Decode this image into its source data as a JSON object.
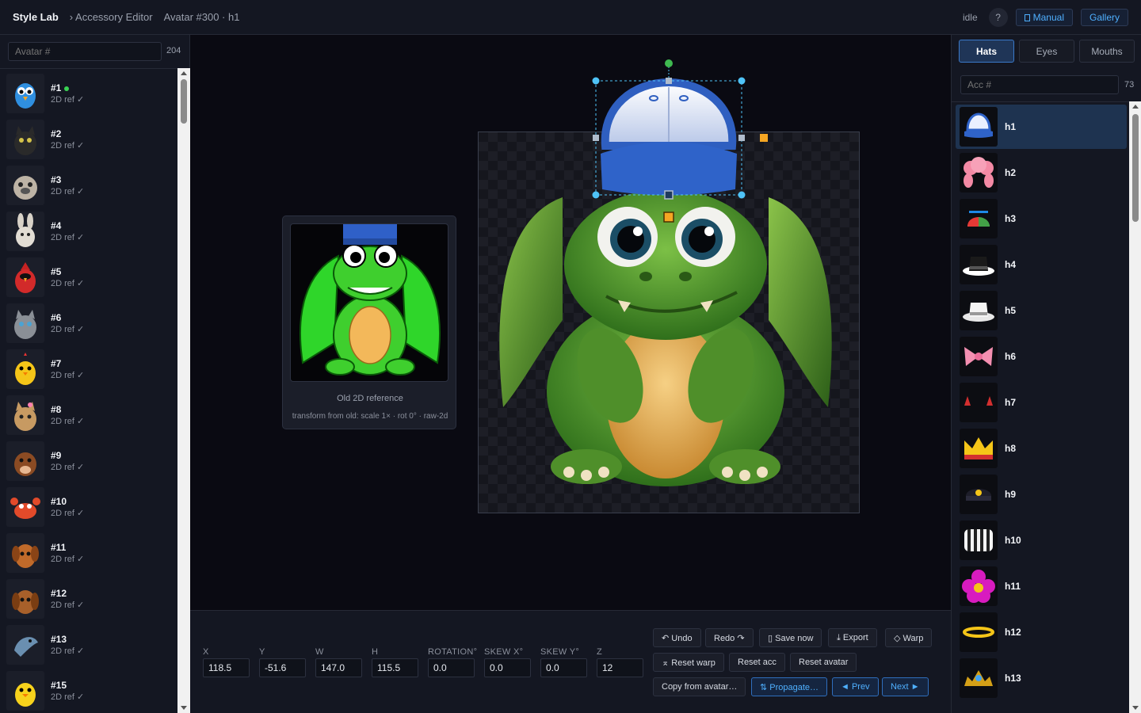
{
  "topbar": {
    "brand": "Style Lab",
    "crumb": "› Accessory Editor",
    "crumb_detail": "Avatar #300 · h1",
    "status": "idle",
    "help_label": "?",
    "manual_label": "Manual",
    "gallery_label": "Gallery"
  },
  "left": {
    "search_placeholder": "Avatar #",
    "count": "204",
    "items": [
      {
        "num": "#1",
        "sub": "2D ref ✓",
        "icon": "bluebird"
      },
      {
        "num": "#2",
        "sub": "2D ref ✓",
        "icon": "black-cat"
      },
      {
        "num": "#3",
        "sub": "2D ref ✓",
        "icon": "bulldog"
      },
      {
        "num": "#4",
        "sub": "2D ref ✓",
        "icon": "bunny"
      },
      {
        "num": "#5",
        "sub": "2D ref ✓",
        "icon": "cardinal"
      },
      {
        "num": "#6",
        "sub": "2D ref ✓",
        "icon": "grey-cat"
      },
      {
        "num": "#7",
        "sub": "2D ref ✓",
        "icon": "chick"
      },
      {
        "num": "#8",
        "sub": "2D ref ✓",
        "icon": "kitten"
      },
      {
        "num": "#9",
        "sub": "2D ref ✓",
        "icon": "calf"
      },
      {
        "num": "#10",
        "sub": "2D ref ✓",
        "icon": "crab"
      },
      {
        "num": "#11",
        "sub": "2D ref ✓",
        "icon": "puppy"
      },
      {
        "num": "#12",
        "sub": "2D ref ✓",
        "icon": "dachshund"
      },
      {
        "num": "#13",
        "sub": "2D ref ✓",
        "icon": "dolphin"
      },
      {
        "num": "#15",
        "sub": "2D ref ✓",
        "icon": "duckling"
      }
    ]
  },
  "reference": {
    "title": "Old 2D reference",
    "subtitle": "transform from old: scale 1× · rot 0° · raw-2d"
  },
  "transform": {
    "fields": [
      {
        "label": "X",
        "value": "118.5"
      },
      {
        "label": "Y",
        "value": "-51.6"
      },
      {
        "label": "W",
        "value": "147.0"
      },
      {
        "label": "H",
        "value": "115.5"
      },
      {
        "label": "ROTATION°",
        "value": "0.0"
      },
      {
        "label": "SKEW X°",
        "value": "0.0"
      },
      {
        "label": "SKEW Y°",
        "value": "0.0"
      },
      {
        "label": "Z",
        "value": "12"
      }
    ]
  },
  "actions": {
    "undo": "↶ Undo",
    "redo": "Redo ↷",
    "save_now": "▯ Save now",
    "export": "⤓ Export",
    "warp": "◇ Warp",
    "reset_warp": "⌅ Reset warp",
    "reset_acc": "Reset acc",
    "reset_avatar": "Reset avatar",
    "copy_from": "Copy from avatar…",
    "propagate": "⇅ Propagate…",
    "prev": "◄ Prev",
    "next": "Next ►"
  },
  "right": {
    "tabs": [
      "Hats",
      "Eyes",
      "Mouths"
    ],
    "search_placeholder": "Acc #",
    "count": "73",
    "items": [
      {
        "name": "h1",
        "icon": "blue-cap"
      },
      {
        "name": "h2",
        "icon": "pink-wig"
      },
      {
        "name": "h3",
        "icon": "propeller-cap"
      },
      {
        "name": "h4",
        "icon": "black-fedora"
      },
      {
        "name": "h5",
        "icon": "white-fedora"
      },
      {
        "name": "h6",
        "icon": "pink-bow"
      },
      {
        "name": "h7",
        "icon": "devil-horns"
      },
      {
        "name": "h8",
        "icon": "crown"
      },
      {
        "name": "h9",
        "icon": "police-cap"
      },
      {
        "name": "h10",
        "icon": "striped-hat"
      },
      {
        "name": "h11",
        "icon": "flower"
      },
      {
        "name": "h12",
        "icon": "halo"
      },
      {
        "name": "h13",
        "icon": "tiara"
      }
    ]
  },
  "colors": {
    "accent": "#4fb0ff",
    "selected_bg": "#1e3350",
    "handle": "#4fc3f7",
    "anchor": "#f5a623",
    "rotate_handle": "#3fb950"
  }
}
